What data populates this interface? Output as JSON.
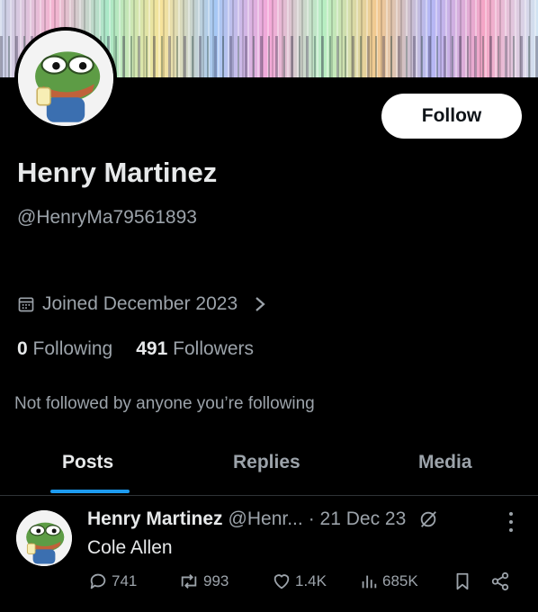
{
  "profile": {
    "name": "Henry Martinez",
    "handle": "@HenryMa79561893",
    "joined": "Joined December 2023",
    "following_count": "0",
    "following_label": "Following",
    "followers_count": "491",
    "followers_label": "Followers",
    "not_followed": "Not followed by anyone you’re following"
  },
  "follow_button": {
    "label": "Follow"
  },
  "tabs": [
    {
      "label": "Posts",
      "active": true
    },
    {
      "label": "Replies",
      "active": false
    },
    {
      "label": "Media",
      "active": false
    }
  ],
  "post": {
    "author": "Henry Martinez",
    "handle": "@Henr...",
    "date": "· 21 Dec 23",
    "text": "Cole Allen",
    "replies": "741",
    "reposts": "993",
    "likes": "1.4K",
    "views": "685K"
  },
  "icons": {
    "calendar": "calendar-icon",
    "chevron": "chevron-right-icon",
    "grok": "grok-icon",
    "more": "more-icon",
    "reply": "reply-icon",
    "repost": "repost-icon",
    "like": "like-icon",
    "views": "views-icon",
    "bookmark": "bookmark-icon",
    "share": "share-icon"
  },
  "colors": {
    "background": "#000000",
    "text": "#e7e9ea",
    "muted": "#9ca3aa",
    "accent": "#1d9bf0",
    "follow_bg": "#ffffff"
  }
}
